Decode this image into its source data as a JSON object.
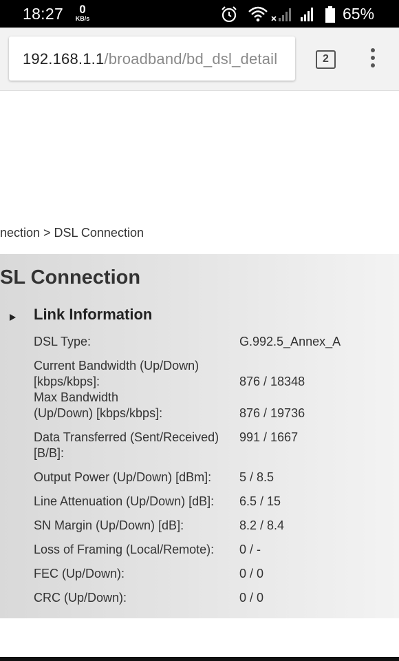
{
  "status_bar": {
    "time": "18:27",
    "net_speed": "0",
    "net_speed_unit": "KB/s",
    "battery": "65%",
    "icons": [
      "alarm-icon",
      "wifi-icon",
      "signal-icon",
      "signal-icon",
      "battery-icon"
    ]
  },
  "browser": {
    "url_host": "192.168.1.1",
    "url_path": "/broadband/bd_dsl_detail",
    "tab_count": "2",
    "menu_icon": "more-vert-icon"
  },
  "page": {
    "breadcrumb": "nection > DSL Connection",
    "title": "SL Connection",
    "section_title": "Link Information",
    "rows": [
      {
        "label": [
          "DSL Type:"
        ],
        "value": "G.992.5_Annex_A"
      },
      {
        "label": [
          "Current Bandwidth (Up/Down)",
          "[kbps/kbps]:"
        ],
        "value": "876 / 18348"
      },
      {
        "label": [
          "Max Bandwidth",
          "(Up/Down) [kbps/kbps]:"
        ],
        "value": "876 / 19736"
      },
      {
        "label": [
          "Data Transferred (Sent/Received)",
          "[B/B]:"
        ],
        "value": "991 / 1667"
      },
      {
        "label": [
          "Output Power (Up/Down) [dBm]:"
        ],
        "value": "5 / 8.5"
      },
      {
        "label": [
          "Line Attenuation (Up/Down) [dB]:"
        ],
        "value": "6.5 / 15"
      },
      {
        "label": [
          "SN Margin (Up/Down) [dB]:"
        ],
        "value": "8.2 / 8.4"
      },
      {
        "label": [
          "Loss of Framing (Local/Remote):"
        ],
        "value": "0 / -"
      },
      {
        "label": [
          "FEC (Up/Down):"
        ],
        "value": "0 / 0"
      },
      {
        "label": [
          "CRC (Up/Down):"
        ],
        "value": "0 / 0"
      }
    ]
  }
}
